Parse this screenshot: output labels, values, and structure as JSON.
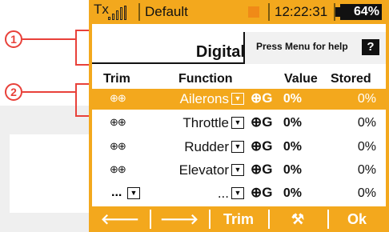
{
  "callouts": [
    "1",
    "2"
  ],
  "status": {
    "tx_label": "Tx",
    "model_name": "Default",
    "time": "12:22:31",
    "battery": "64%",
    "signal_level": 4
  },
  "title": {
    "page_title": "Digital",
    "help_text": "Press Menu for help",
    "help_icon": "?"
  },
  "table": {
    "headers": {
      "trim": "Trim",
      "function": "Function",
      "value": "Value",
      "stored": "Stored"
    },
    "rows": [
      {
        "trim_icon": "⊕⊕",
        "function": "Ailerons",
        "value": "0%",
        "stored": "0%"
      },
      {
        "trim_icon": "⊕⊕",
        "function": "Throttle",
        "value": "0%",
        "stored": "0%"
      },
      {
        "trim_icon": "⊕⊕",
        "function": "Rudder",
        "value": "0%",
        "stored": "0%"
      },
      {
        "trim_icon": "⊕⊕",
        "function": "Elevator",
        "value": "0%",
        "stored": "0%"
      },
      {
        "trim_icon": "...",
        "function": "...",
        "value": "0%",
        "stored": "0%"
      }
    ],
    "group_icon": "⊕G",
    "dropdown_glyph": "▼"
  },
  "fkeys": {
    "f1": "🡐",
    "f2": "🡒",
    "f3": "Trim",
    "f4": "⚒",
    "f5": "Ok"
  },
  "colors": {
    "accent": "#f3a81d",
    "callout": "#e8413a"
  }
}
